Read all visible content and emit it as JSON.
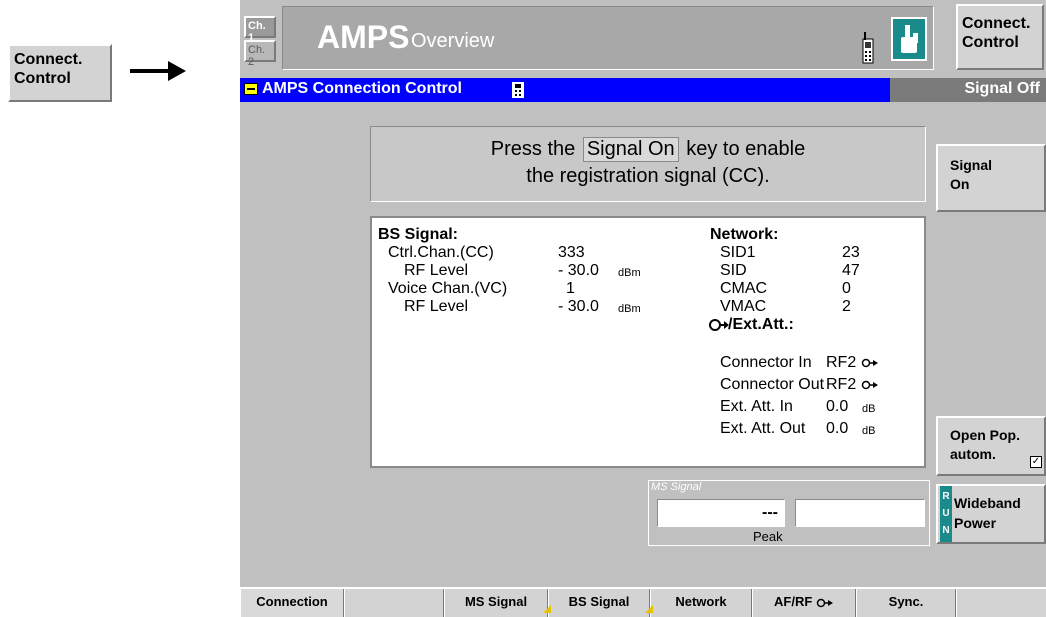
{
  "outer": {
    "connect_button": {
      "line1": "Connect.",
      "line2": "Control"
    }
  },
  "header": {
    "ch1": "Ch. 1",
    "ch2": "Ch. 2",
    "title_big": "AMPS",
    "title_small": "Overview",
    "connect_control": {
      "line1": "Connect.",
      "line2": "Control"
    }
  },
  "panel": {
    "title": "AMPS Connection Control",
    "status": "Signal Off"
  },
  "message": {
    "prefix": "Press the",
    "key": "Signal On",
    "suffix": "key to enable",
    "line2": "the registration signal (CC)."
  },
  "bs_signal": {
    "heading": "BS Signal:",
    "rows": [
      {
        "label": "Ctrl.Chan.(CC)",
        "value": "333",
        "unit": ""
      },
      {
        "label": "RF Level",
        "value": "- 30.0",
        "unit": "dBm"
      },
      {
        "label": "Voice Chan.(VC)",
        "value": "1",
        "unit": ""
      },
      {
        "label": "RF Level",
        "value": "- 30.0",
        "unit": "dBm"
      }
    ]
  },
  "network": {
    "heading": "Network:",
    "rows": [
      {
        "label": "SID1",
        "value": "23"
      },
      {
        "label": "SID",
        "value": "47"
      },
      {
        "label": "CMAC",
        "value": "0"
      },
      {
        "label": "VMAC",
        "value": "2"
      }
    ]
  },
  "ext_att": {
    "heading": "/Ext.Att.:",
    "rows": [
      {
        "label": "Connector In",
        "value": "RF2",
        "unit": ""
      },
      {
        "label": "Connector Out",
        "value": "RF2",
        "unit": ""
      },
      {
        "label": "Ext. Att. In",
        "value": "0.0",
        "unit": "dB"
      },
      {
        "label": "Ext. Att. Out",
        "value": "0.0",
        "unit": "dB"
      }
    ]
  },
  "right_softkeys": {
    "signal_on": {
      "line1": "Signal",
      "line2": "On"
    },
    "open_pop": {
      "line1": "Open Pop.",
      "line2": "autom."
    },
    "wideband": {
      "run": [
        "R",
        "U",
        "N"
      ],
      "line1": "Wideband",
      "line2": "Power"
    }
  },
  "ms_signal": {
    "label": "MS Signal",
    "value": "---",
    "peak_label": "Peak"
  },
  "bottom_tabs": [
    "Connection",
    "",
    "MS Signal",
    "BS Signal",
    "Network",
    "AF/RF",
    "Sync.",
    ""
  ],
  "colors": {
    "panel_bg": "#c0c0c0",
    "title_bar": "#0000ff",
    "accent_teal": "#1a8a8a",
    "status_bar": "#7a7a7a"
  }
}
